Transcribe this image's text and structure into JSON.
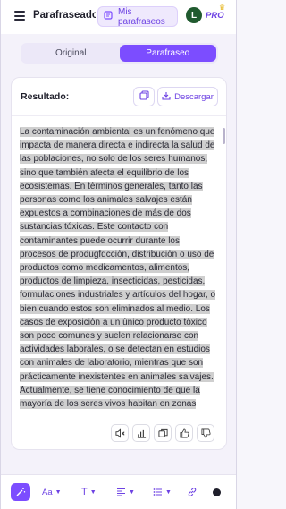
{
  "header": {
    "app_title": "Parafraseador",
    "my_paraphrases_label": "Mis parafraseos",
    "avatar_initial": "L",
    "pro_label": "PRO"
  },
  "tabs": [
    {
      "label": "Original",
      "active": false
    },
    {
      "label": "Parafraseo",
      "active": true
    }
  ],
  "result": {
    "label": "Resultado:",
    "download_label": "Descargar",
    "text": "La contaminación ambiental es un fenómeno que impacta de manera directa e indirecta la salud de las poblaciones, no solo de los seres humanos, sino que también afecta el equilibrio de los ecosistemas. En términos generales, tanto las personas como los animales salvajes están expuestos a combinaciones de más de dos sustancias tóxicas. Este contacto con contaminantes puede ocurrir durante los procesos de produgfdcción, distribución o uso de productos como medicamentos, alimentos, productos de limpieza, insecticidas, pesticidas, formulaciones industriales y artículos del hogar, o bien cuando estos son eliminados al medio. Los casos de exposición a un único producto tóxico son poco comunes y suelen relacionarse con actividades laborales, o se detectan en estudios con animales de laboratorio, mientras que son prácticamente inexistentes en animales salvajes. Actualmente, se tiene conocimiento de que la mayoría de los seres vivos habitan en zonas donde la contaminación ambiental supera los"
  },
  "toolbar": {
    "font_label": "Aa",
    "text_label": "T"
  },
  "colors": {
    "accent": "#7c4dff",
    "highlight": "#cfcfcf"
  }
}
